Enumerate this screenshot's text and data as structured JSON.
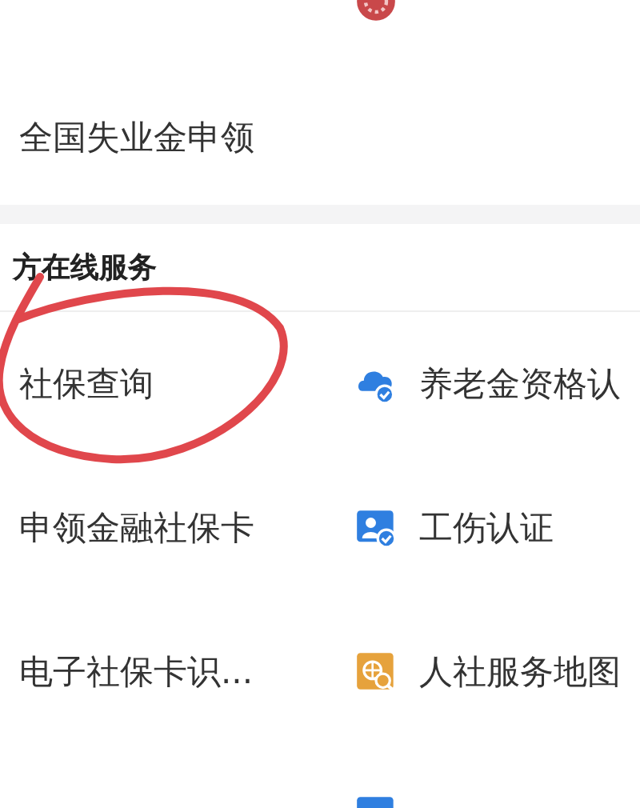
{
  "top_items": [
    {
      "label": "全国失业金申领",
      "circled": false
    }
  ],
  "section": {
    "title": "方在线服务",
    "items": [
      {
        "label": "社保查询",
        "circled": true
      },
      {
        "label": "养老金资格认",
        "circled": false
      },
      {
        "label": "申领金融社保卡",
        "circled": false
      },
      {
        "label": "工伤认证",
        "circled": false
      },
      {
        "label": "电子社保卡识...",
        "circled": false
      },
      {
        "label": "人社服务地图",
        "circled": false
      }
    ]
  }
}
